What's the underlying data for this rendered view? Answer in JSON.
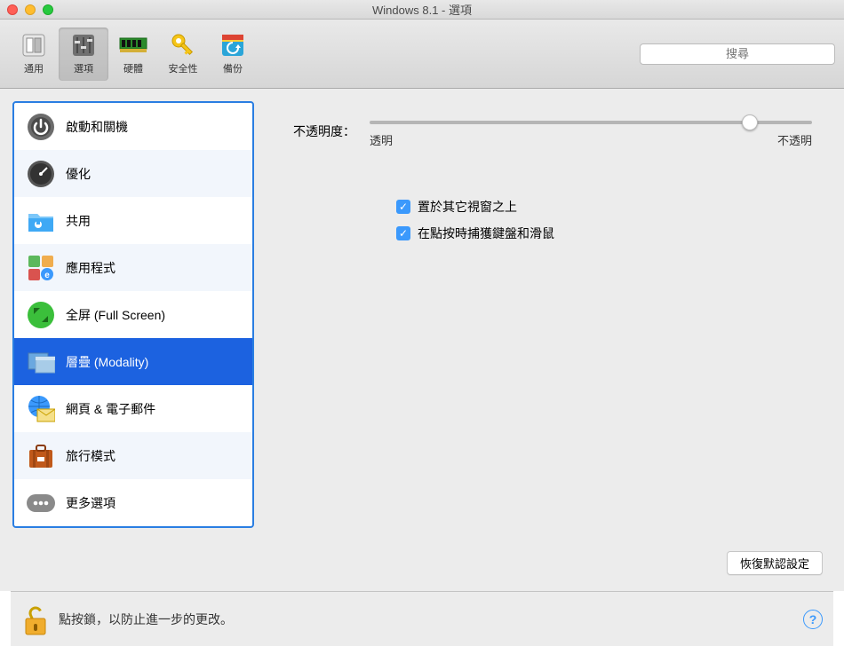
{
  "window": {
    "title": "Windows 8.1 - 選項"
  },
  "toolbar": {
    "items": [
      {
        "label": "通用"
      },
      {
        "label": "選項"
      },
      {
        "label": "硬體"
      },
      {
        "label": "安全性"
      },
      {
        "label": "備份"
      }
    ],
    "search_placeholder": "搜尋"
  },
  "sidebar": {
    "items": [
      {
        "label": "啟動和關機"
      },
      {
        "label": "優化"
      },
      {
        "label": "共用"
      },
      {
        "label": "應用程式"
      },
      {
        "label": "全屏 (Full Screen)"
      },
      {
        "label": "層疊 (Modality)"
      },
      {
        "label": "網頁 & 電子郵件"
      },
      {
        "label": "旅行模式"
      },
      {
        "label": "更多選項"
      }
    ],
    "selected_index": 5
  },
  "pane": {
    "opacity_label": "不透明度：",
    "slider_min_label": "透明",
    "slider_max_label": "不透明",
    "slider_value_percent": 86,
    "check1": "置於其它視窗之上",
    "check2": "在點按時捕獲鍵盤和滑鼠",
    "restore_button": "恢復默認設定"
  },
  "footer": {
    "lock_text": "點按鎖，以防止進一步的更改。",
    "help_char": "?"
  }
}
